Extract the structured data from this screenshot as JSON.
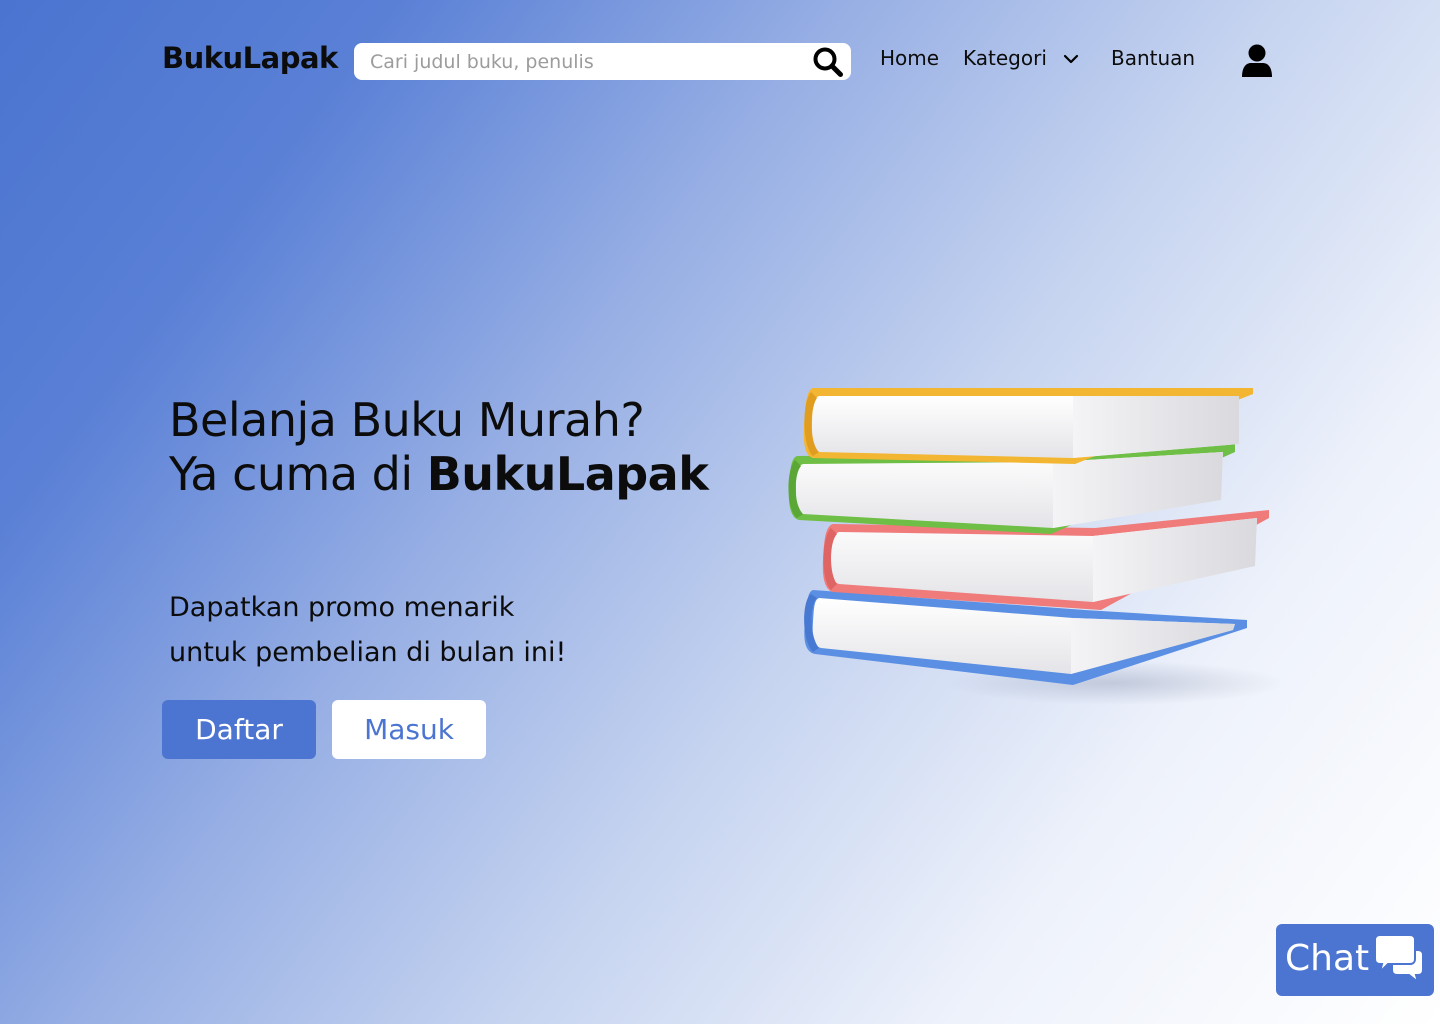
{
  "header": {
    "logo": "BukuLapak",
    "search_placeholder": "Cari judul buku, penulis",
    "nav": {
      "home": "Home",
      "kategori": "Kategori",
      "bantuan": "Bantuan"
    }
  },
  "hero": {
    "title_line1": "Belanja Buku Murah?",
    "title_line2_prefix": "Ya cuma di ",
    "title_line2_brand": "BukuLapak",
    "subtitle_line1": "Dapatkan promo menarik",
    "subtitle_line2": "untuk pembelian di bulan ini!",
    "register_label": "Daftar",
    "login_label": "Masuk"
  },
  "chat": {
    "label": "Chat"
  },
  "icons": {
    "search": "search-icon",
    "dropdown": "chevron-down-icon",
    "user": "user-icon",
    "chat": "chat-bubbles-icon"
  },
  "colors": {
    "accent": "#4c74d1",
    "text": "#0c0c0c",
    "placeholder": "#9c9c9c",
    "book_yellow": "#f2b632",
    "book_green": "#6fbe45",
    "book_red": "#f07b7b",
    "book_blue": "#5b8fe4"
  }
}
